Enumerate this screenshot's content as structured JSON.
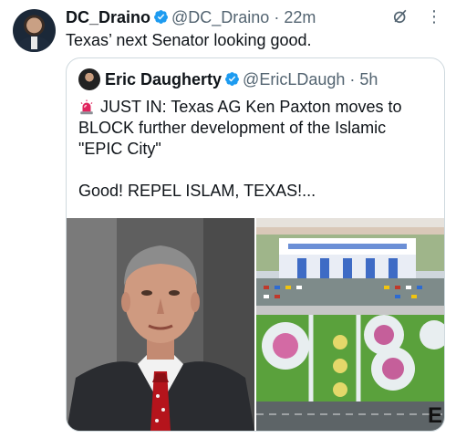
{
  "tweet": {
    "author_name": "DC_Draino",
    "handle": "@DC_Draino",
    "separator": "·",
    "time": "22m",
    "text": "Texas’ next Senator looking good."
  },
  "quote": {
    "author_name": "Eric Daugherty",
    "handle": "@EricLDaugh",
    "separator": "·",
    "time": "5h",
    "line1": "JUST IN: Texas AG Ken Paxton moves to BLOCK further development of the Islamic \"EPIC City\"",
    "line2": "Good! REPEL ISLAM, TEXAS!...",
    "image_right_overlay": "E"
  },
  "icons": {
    "verified": "verified-badge-icon",
    "grok": "grok-icon",
    "more": "more-options-icon",
    "siren": "siren-emoji-icon"
  },
  "colors": {
    "verified_blue": "#1d9bf0",
    "text": "#0f1419",
    "muted": "#536471",
    "border": "#cfd9de"
  }
}
